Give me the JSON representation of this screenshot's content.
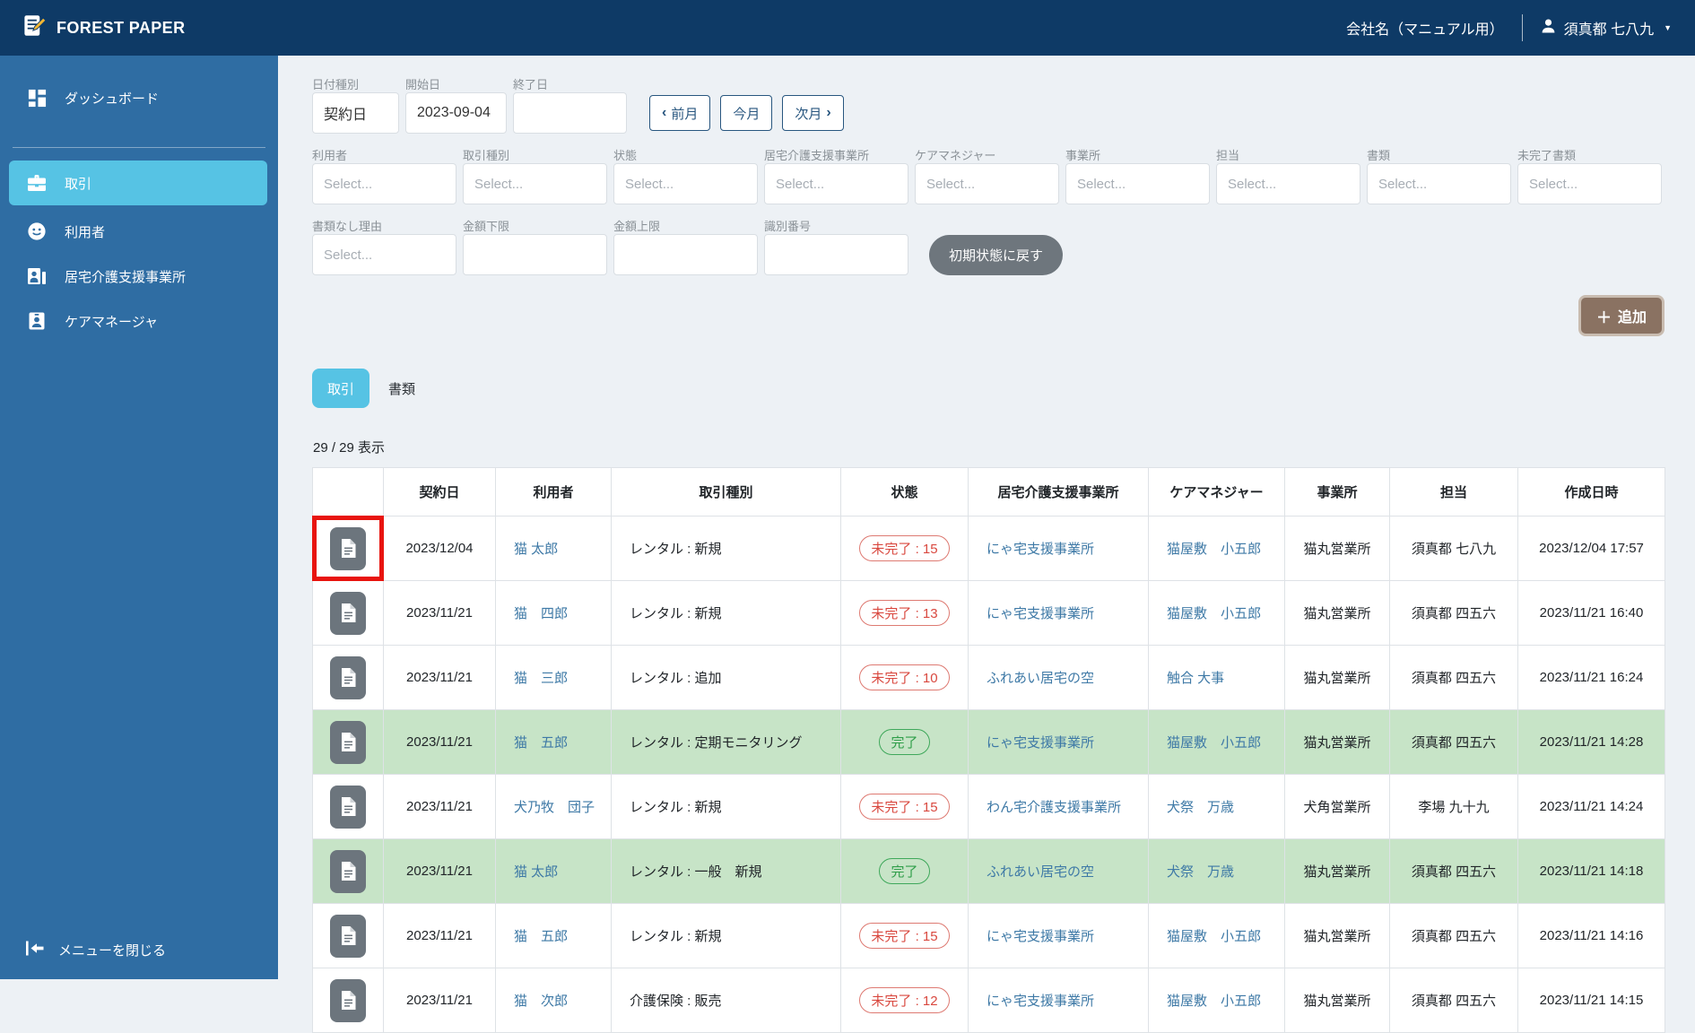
{
  "app": {
    "name": "FOREST PAPER"
  },
  "header": {
    "company": "会社名（マニュアル用）",
    "user_name": "須真都 七八九",
    "caret": "▼"
  },
  "sidebar": {
    "items": [
      {
        "id": "dashboard",
        "label": "ダッシュボード",
        "active": false,
        "icon": "dashboard-icon"
      },
      {
        "id": "transactions",
        "label": "取引",
        "active": true,
        "icon": "briefcase-icon"
      },
      {
        "id": "users",
        "label": "利用者",
        "active": false,
        "icon": "user-face-icon"
      },
      {
        "id": "care-offices",
        "label": "居宅介護支援事業所",
        "active": false,
        "icon": "office-person-icon"
      },
      {
        "id": "care-managers",
        "label": "ケアマネージャ",
        "active": false,
        "icon": "id-badge-icon"
      }
    ],
    "close_menu": "メニューを閉じる"
  },
  "filters": {
    "date_type": {
      "label": "日付種別",
      "value": "契約日"
    },
    "start_date": {
      "label": "開始日",
      "value": "2023-09-04"
    },
    "end_date": {
      "label": "終了日",
      "value": ""
    },
    "month_nav": {
      "prev": "前月",
      "today": "今月",
      "next": "次月",
      "chev_left": "‹",
      "chev_right": "›"
    },
    "selects": [
      {
        "label": "利用者",
        "placeholder": "Select..."
      },
      {
        "label": "取引種別",
        "placeholder": "Select..."
      },
      {
        "label": "状態",
        "placeholder": "Select..."
      },
      {
        "label": "居宅介護支援事業所",
        "placeholder": "Select..."
      },
      {
        "label": "ケアマネジャー",
        "placeholder": "Select..."
      },
      {
        "label": "事業所",
        "placeholder": "Select..."
      },
      {
        "label": "担当",
        "placeholder": "Select..."
      },
      {
        "label": "書類",
        "placeholder": "Select..."
      },
      {
        "label": "未完了書類",
        "placeholder": "Select..."
      }
    ],
    "no_doc_reason": {
      "label": "書類なし理由",
      "placeholder": "Select..."
    },
    "amount_min": {
      "label": "金額下限",
      "value": ""
    },
    "amount_max": {
      "label": "金額上限",
      "value": ""
    },
    "id_number": {
      "label": "識別番号",
      "value": ""
    },
    "reset_button": "初期状態に戻す"
  },
  "actions": {
    "add_button": "追加",
    "plus": "＋"
  },
  "tabs": [
    {
      "label": "取引",
      "active": true
    },
    {
      "label": "書類",
      "active": false
    }
  ],
  "result_count": "29 / 29 表示",
  "table": {
    "headers": [
      "",
      "契約日",
      "利用者",
      "取引種別",
      "状態",
      "居宅介護支援事業所",
      "ケアマネジャー",
      "事業所",
      "担当",
      "作成日時"
    ],
    "rows": [
      {
        "date": "2023/12/04",
        "user": "猫 太郎",
        "type": "レンタル : 新規",
        "status": "未完了 : 15",
        "status_kind": "incomplete",
        "office": "にゃ宅支援事業所",
        "care_manager": "猫屋敷　小五郎",
        "branch": "猫丸営業所",
        "staff": "須真都 七八九",
        "created": "2023/12/04 17:57",
        "highlighted": true
      },
      {
        "date": "2023/11/21",
        "user": "猫　四郎",
        "type": "レンタル : 新規",
        "status": "未完了 : 13",
        "status_kind": "incomplete",
        "office": "にゃ宅支援事業所",
        "care_manager": "猫屋敷　小五郎",
        "branch": "猫丸営業所",
        "staff": "須真都 四五六",
        "created": "2023/11/21 16:40",
        "highlighted": false
      },
      {
        "date": "2023/11/21",
        "user": "猫　三郎",
        "type": "レンタル : 追加",
        "status": "未完了 : 10",
        "status_kind": "incomplete",
        "office": "ふれあい居宅の空",
        "care_manager": "触合 大事",
        "branch": "猫丸営業所",
        "staff": "須真都 四五六",
        "created": "2023/11/21 16:24",
        "highlighted": false
      },
      {
        "date": "2023/11/21",
        "user": "猫　五郎",
        "type": "レンタル : 定期モニタリング",
        "status": "完了",
        "status_kind": "complete",
        "office": "にゃ宅支援事業所",
        "care_manager": "猫屋敷　小五郎",
        "branch": "猫丸営業所",
        "staff": "須真都 四五六",
        "created": "2023/11/21 14:28",
        "highlighted": false
      },
      {
        "date": "2023/11/21",
        "user": "犬乃牧　団子",
        "type": "レンタル : 新規",
        "status": "未完了 : 15",
        "status_kind": "incomplete",
        "office": "わん宅介護支援事業所",
        "care_manager": "犬祭　万歳",
        "branch": "犬角営業所",
        "staff": "李場 九十九",
        "created": "2023/11/21 14:24",
        "highlighted": false
      },
      {
        "date": "2023/11/21",
        "user": "猫 太郎",
        "type": "レンタル : 一般　新規",
        "status": "完了",
        "status_kind": "complete",
        "office": "ふれあい居宅の空",
        "care_manager": "犬祭　万歳",
        "branch": "猫丸営業所",
        "staff": "須真都 四五六",
        "created": "2023/11/21 14:18",
        "highlighted": false
      },
      {
        "date": "2023/11/21",
        "user": "猫　五郎",
        "type": "レンタル : 新規",
        "status": "未完了 : 15",
        "status_kind": "incomplete",
        "office": "にゃ宅支援事業所",
        "care_manager": "猫屋敷　小五郎",
        "branch": "猫丸営業所",
        "staff": "須真都 四五六",
        "created": "2023/11/21 14:16",
        "highlighted": false
      },
      {
        "date": "2023/11/21",
        "user": "猫　次郎",
        "type": "介護保険 : 販売",
        "status": "未完了 : 12",
        "status_kind": "incomplete",
        "office": "にゃ宅支援事業所",
        "care_manager": "猫屋敷　小五郎",
        "branch": "猫丸営業所",
        "staff": "須真都 四五六",
        "created": "2023/11/21 14:15",
        "highlighted": false
      }
    ]
  },
  "colors": {
    "header_bg": "#0e3a66",
    "sidebar_bg": "#2f6da3",
    "active_accent": "#56c3e4",
    "add_button": "#8a7262",
    "status_incomplete": "#d9483f",
    "status_complete": "#2f9e49",
    "complete_row_bg": "#c7e4c7",
    "highlight_red": "#e8140f",
    "link": "#3e79a6"
  }
}
